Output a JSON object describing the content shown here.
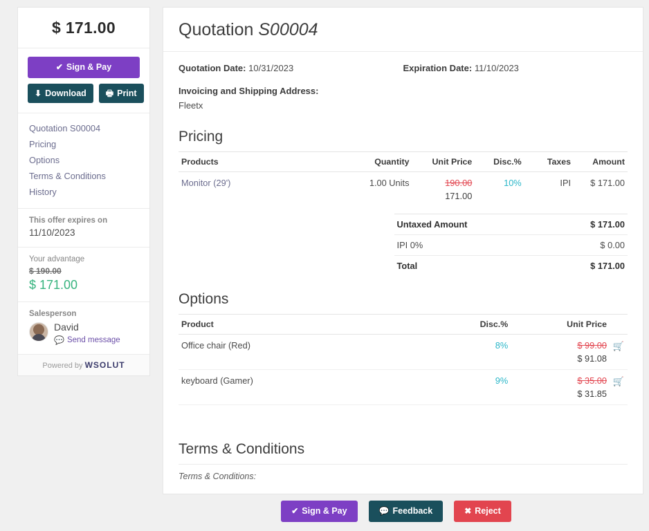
{
  "sidebar": {
    "amount": "$ 171.00",
    "sign_pay_label": "Sign & Pay",
    "download_label": "Download",
    "print_label": "Print",
    "nav": [
      {
        "label": "Quotation S00004"
      },
      {
        "label": "Pricing"
      },
      {
        "label": "Options"
      },
      {
        "label": "Terms & Conditions"
      },
      {
        "label": "History"
      }
    ],
    "expires_label": "This offer expires on",
    "expires_date": "11/10/2023",
    "advantage_label": "Your advantage",
    "advantage_old": "$ 190.00",
    "advantage_new": "$ 171.00",
    "salesperson_label": "Salesperson",
    "salesperson_name": "David",
    "send_message_label": "Send message",
    "powered_by": "Powered by",
    "brand": "WSOLUT"
  },
  "document": {
    "title_prefix": "Quotation",
    "title_ref": "S00004",
    "quotation_date_label": "Quotation Date:",
    "quotation_date": "10/31/2023",
    "expiration_date_label": "Expiration Date:",
    "expiration_date": "11/10/2023",
    "address_label": "Invoicing and Shipping Address:",
    "address_value": "Fleetx"
  },
  "pricing": {
    "heading": "Pricing",
    "columns": {
      "products": "Products",
      "quantity": "Quantity",
      "unit_price": "Unit Price",
      "discount": "Disc.%",
      "taxes": "Taxes",
      "amount": "Amount"
    },
    "rows": [
      {
        "product": "Monitor (29')",
        "quantity": "1.00 Units",
        "unit_price_old": "190.00",
        "unit_price_new": "171.00",
        "discount": "10%",
        "taxes": "IPI",
        "amount": "$ 171.00"
      }
    ],
    "totals": [
      {
        "label": "Untaxed Amount",
        "value": "$ 171.00",
        "bold": true
      },
      {
        "label": "IPI 0%",
        "value": "$ 0.00",
        "bold": false
      },
      {
        "label": "Total",
        "value": "$ 171.00",
        "bold": true
      }
    ]
  },
  "options": {
    "heading": "Options",
    "columns": {
      "product": "Product",
      "discount": "Disc.%",
      "unit_price": "Unit Price"
    },
    "rows": [
      {
        "product": "Office chair (Red)",
        "discount": "8%",
        "price_old": "$ 99.00",
        "price_new": "$ 91.08",
        "cart_icon": "cart-icon"
      },
      {
        "product": "keyboard (Gamer)",
        "discount": "9%",
        "price_old": "$ 35.00",
        "price_new": "$ 31.85",
        "cart_icon": "cart-icon"
      }
    ]
  },
  "terms": {
    "heading": "Terms & Conditions",
    "body": "Terms & Conditions:"
  },
  "footer": {
    "sign_pay_label": "Sign & Pay",
    "feedback_label": "Feedback",
    "reject_label": "Reject"
  },
  "colors": {
    "purple": "#7d3fc4",
    "teal": "#1a4f5c",
    "red": "#e2454f",
    "green": "#36b37e",
    "cyan": "#29b6c8",
    "link": "#6b6c8e"
  }
}
